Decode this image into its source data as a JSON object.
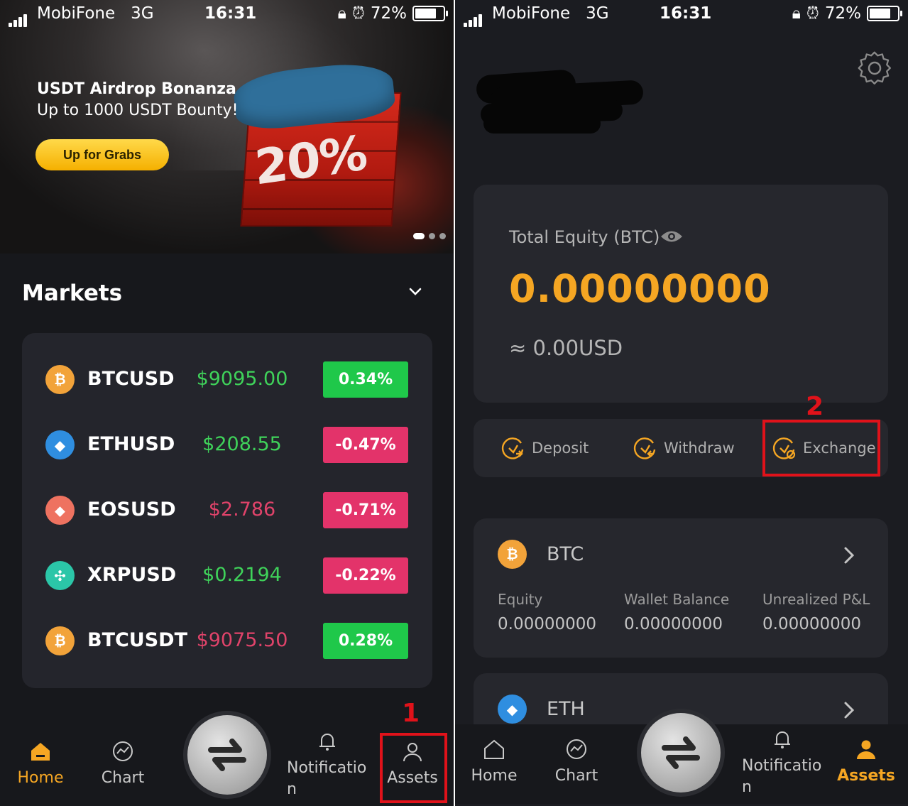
{
  "left_phone": {
    "status": {
      "carrier": "MobiFone",
      "network": "3G",
      "time": "16:31",
      "battery": "72%"
    },
    "banner": {
      "title": "USDT Airdrop Bonanza",
      "subtitle": "Up to 1000 USDT Bounty!",
      "button": "Up for Grabs",
      "crate_text": "20%",
      "slide_count": 3,
      "active_slide": 1
    },
    "markets": {
      "title": "Markets",
      "rows": [
        {
          "symbol": "BTCUSD",
          "price": "$9095.00",
          "change": "0.34%",
          "direction": "up",
          "coin_icon": "bitcoin-icon",
          "coin_color": "#f2a33a",
          "glyph": "₿"
        },
        {
          "symbol": "ETHUSD",
          "price": "$208.55",
          "change": "-0.47%",
          "direction": "down",
          "coin_icon": "ethereum-icon",
          "coin_color": "#2f8ee0",
          "glyph": "◆"
        },
        {
          "symbol": "EOSUSD",
          "price": "$2.786",
          "change": "-0.71%",
          "direction": "down",
          "coin_icon": "eos-icon",
          "coin_color": "#ee7260",
          "glyph": "⬥"
        },
        {
          "symbol": "XRPUSD",
          "price": "$0.2194",
          "change": "-0.22%",
          "direction": "down",
          "coin_icon": "xrp-icon",
          "coin_color": "#2bc6a8",
          "glyph": "✣"
        },
        {
          "symbol": "BTCUSDT",
          "price": "$9075.50",
          "change": "0.28%",
          "direction": "up",
          "coin_icon": "bitcoin-icon",
          "coin_color": "#f2a33a",
          "glyph": "₿"
        }
      ]
    },
    "nav": {
      "home": "Home",
      "chart": "Chart",
      "notification": "Notificatio n",
      "assets": "Assets",
      "active": "home"
    },
    "annotation": "1"
  },
  "right_phone": {
    "status": {
      "carrier": "MobiFone",
      "network": "3G",
      "time": "16:31",
      "battery": "72%"
    },
    "equity": {
      "label": "Total Equity (BTC)",
      "value": "0.00000000",
      "usd": "≈ 0.00USD"
    },
    "actions": {
      "deposit": "Deposit",
      "withdraw": "Withdraw",
      "exchange": "Exchange"
    },
    "annotation": "2",
    "coins": [
      {
        "name": "BTC",
        "glyph": "₿",
        "color": "#f2a33a",
        "cols": [
          {
            "label": "Equity",
            "value": "0.00000000"
          },
          {
            "label": "Wallet Balance",
            "value": "0.00000000"
          },
          {
            "label": "Unrealized P&L",
            "value": "0.00000000"
          }
        ]
      },
      {
        "name": "ETH",
        "glyph": "◆",
        "color": "#2f8ee0"
      }
    ],
    "nav": {
      "home": "Home",
      "chart": "Chart",
      "notification": "Notificatio n",
      "assets": "Assets",
      "active": "assets"
    }
  },
  "colors": {
    "accent": "#f5a623",
    "up": "#1fc84a",
    "down": "#e3336a",
    "annotation_red": "#e0121a"
  }
}
